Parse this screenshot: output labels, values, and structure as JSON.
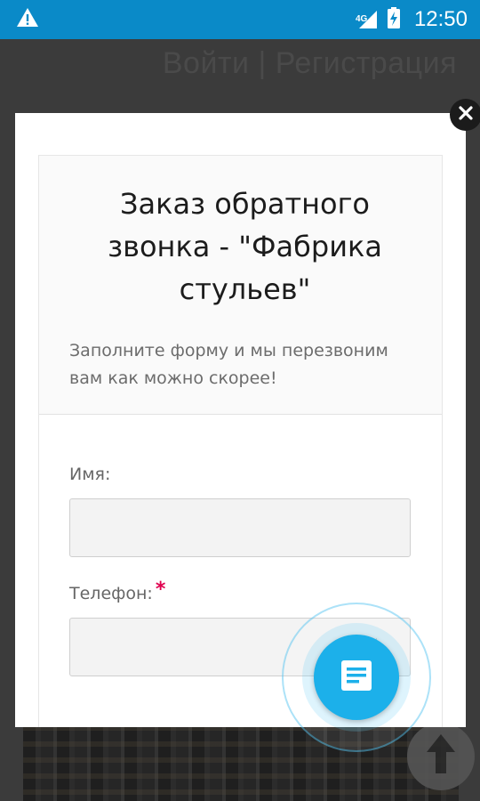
{
  "status_bar": {
    "network": "4G",
    "time": "12:50",
    "warning_icon": "warning-icon",
    "signal_icon": "signal-icon",
    "battery_icon": "battery-charging-icon"
  },
  "background": {
    "auth_link": "Войти | Регистрация"
  },
  "modal": {
    "title": "Заказ обратного звонка - \"Фабрика стульев\"",
    "description": "Заполните форму и мы перезвоним вам как можно скорее!",
    "fields": [
      {
        "label": "Имя:",
        "value": "",
        "required": false
      },
      {
        "label": "Телефон:",
        "value": "",
        "required": true,
        "required_mark": "*"
      }
    ],
    "close_icon": "close-icon"
  },
  "fab": {
    "icon": "form-icon"
  },
  "colors": {
    "status_bar": "#0a8ac8",
    "fab": "#1cb0ea",
    "required": "#e0004e"
  }
}
